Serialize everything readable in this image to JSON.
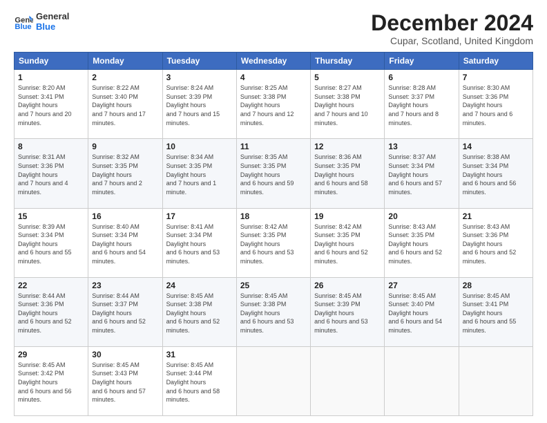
{
  "logo": {
    "line1": "General",
    "line2": "Blue"
  },
  "title": "December 2024",
  "subtitle": "Cupar, Scotland, United Kingdom",
  "days_of_week": [
    "Sunday",
    "Monday",
    "Tuesday",
    "Wednesday",
    "Thursday",
    "Friday",
    "Saturday"
  ],
  "weeks": [
    [
      {
        "day": "1",
        "sunrise": "8:20 AM",
        "sunset": "3:41 PM",
        "daylight": "7 hours and 20 minutes."
      },
      {
        "day": "2",
        "sunrise": "8:22 AM",
        "sunset": "3:40 PM",
        "daylight": "7 hours and 17 minutes."
      },
      {
        "day": "3",
        "sunrise": "8:24 AM",
        "sunset": "3:39 PM",
        "daylight": "7 hours and 15 minutes."
      },
      {
        "day": "4",
        "sunrise": "8:25 AM",
        "sunset": "3:38 PM",
        "daylight": "7 hours and 12 minutes."
      },
      {
        "day": "5",
        "sunrise": "8:27 AM",
        "sunset": "3:38 PM",
        "daylight": "7 hours and 10 minutes."
      },
      {
        "day": "6",
        "sunrise": "8:28 AM",
        "sunset": "3:37 PM",
        "daylight": "7 hours and 8 minutes."
      },
      {
        "day": "7",
        "sunrise": "8:30 AM",
        "sunset": "3:36 PM",
        "daylight": "7 hours and 6 minutes."
      }
    ],
    [
      {
        "day": "8",
        "sunrise": "8:31 AM",
        "sunset": "3:36 PM",
        "daylight": "7 hours and 4 minutes."
      },
      {
        "day": "9",
        "sunrise": "8:32 AM",
        "sunset": "3:35 PM",
        "daylight": "7 hours and 2 minutes."
      },
      {
        "day": "10",
        "sunrise": "8:34 AM",
        "sunset": "3:35 PM",
        "daylight": "7 hours and 1 minute."
      },
      {
        "day": "11",
        "sunrise": "8:35 AM",
        "sunset": "3:35 PM",
        "daylight": "6 hours and 59 minutes."
      },
      {
        "day": "12",
        "sunrise": "8:36 AM",
        "sunset": "3:35 PM",
        "daylight": "6 hours and 58 minutes."
      },
      {
        "day": "13",
        "sunrise": "8:37 AM",
        "sunset": "3:34 PM",
        "daylight": "6 hours and 57 minutes."
      },
      {
        "day": "14",
        "sunrise": "8:38 AM",
        "sunset": "3:34 PM",
        "daylight": "6 hours and 56 minutes."
      }
    ],
    [
      {
        "day": "15",
        "sunrise": "8:39 AM",
        "sunset": "3:34 PM",
        "daylight": "6 hours and 55 minutes."
      },
      {
        "day": "16",
        "sunrise": "8:40 AM",
        "sunset": "3:34 PM",
        "daylight": "6 hours and 54 minutes."
      },
      {
        "day": "17",
        "sunrise": "8:41 AM",
        "sunset": "3:34 PM",
        "daylight": "6 hours and 53 minutes."
      },
      {
        "day": "18",
        "sunrise": "8:42 AM",
        "sunset": "3:35 PM",
        "daylight": "6 hours and 53 minutes."
      },
      {
        "day": "19",
        "sunrise": "8:42 AM",
        "sunset": "3:35 PM",
        "daylight": "6 hours and 52 minutes."
      },
      {
        "day": "20",
        "sunrise": "8:43 AM",
        "sunset": "3:35 PM",
        "daylight": "6 hours and 52 minutes."
      },
      {
        "day": "21",
        "sunrise": "8:43 AM",
        "sunset": "3:36 PM",
        "daylight": "6 hours and 52 minutes."
      }
    ],
    [
      {
        "day": "22",
        "sunrise": "8:44 AM",
        "sunset": "3:36 PM",
        "daylight": "6 hours and 52 minutes."
      },
      {
        "day": "23",
        "sunrise": "8:44 AM",
        "sunset": "3:37 PM",
        "daylight": "6 hours and 52 minutes."
      },
      {
        "day": "24",
        "sunrise": "8:45 AM",
        "sunset": "3:38 PM",
        "daylight": "6 hours and 52 minutes."
      },
      {
        "day": "25",
        "sunrise": "8:45 AM",
        "sunset": "3:38 PM",
        "daylight": "6 hours and 53 minutes."
      },
      {
        "day": "26",
        "sunrise": "8:45 AM",
        "sunset": "3:39 PM",
        "daylight": "6 hours and 53 minutes."
      },
      {
        "day": "27",
        "sunrise": "8:45 AM",
        "sunset": "3:40 PM",
        "daylight": "6 hours and 54 minutes."
      },
      {
        "day": "28",
        "sunrise": "8:45 AM",
        "sunset": "3:41 PM",
        "daylight": "6 hours and 55 minutes."
      }
    ],
    [
      {
        "day": "29",
        "sunrise": "8:45 AM",
        "sunset": "3:42 PM",
        "daylight": "6 hours and 56 minutes."
      },
      {
        "day": "30",
        "sunrise": "8:45 AM",
        "sunset": "3:43 PM",
        "daylight": "6 hours and 57 minutes."
      },
      {
        "day": "31",
        "sunrise": "8:45 AM",
        "sunset": "3:44 PM",
        "daylight": "6 hours and 58 minutes."
      },
      null,
      null,
      null,
      null
    ]
  ]
}
